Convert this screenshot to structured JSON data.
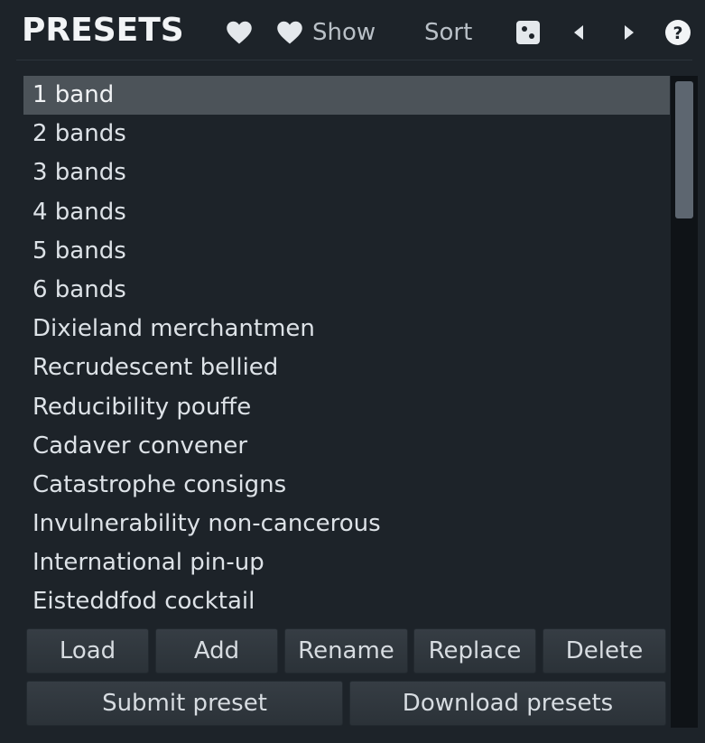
{
  "header": {
    "title": "PRESETS",
    "icons": {
      "favorite": "heart-icon",
      "show_favorites": "heart-icon",
      "random": "dice-icon",
      "previous": "triangle-left-icon",
      "next": "triangle-right-icon",
      "help": "question-circle-icon"
    },
    "show_label": "Show",
    "sort_label": "Sort"
  },
  "presets": {
    "selected_index": 0,
    "items": [
      "1 band",
      "2 bands",
      "3 bands",
      "4 bands",
      "5 bands",
      "6 bands",
      "Dixieland merchantmen",
      "Recrudescent bellied",
      "Reducibility pouffe",
      "Cadaver convener",
      "Catastrophe consigns",
      "Invulnerability non-cancerous",
      "International pin-up",
      "Eisteddfod cocktail"
    ]
  },
  "buttons": {
    "load": "Load",
    "add": "Add",
    "rename": "Rename",
    "replace": "Replace",
    "delete": "Delete",
    "submit": "Submit preset",
    "download": "Download presets"
  },
  "colors": {
    "background": "#1d2329",
    "selected_row": "#4c5359",
    "text": "#dde2e7",
    "scrollbar_track": "#0f1317",
    "scrollbar_thumb": "#5d6670"
  }
}
